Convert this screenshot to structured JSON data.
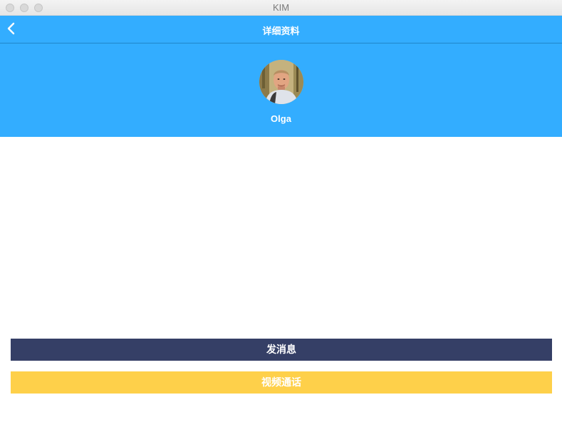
{
  "window": {
    "title": "KIM"
  },
  "navbar": {
    "back_icon": "chevron-left-icon",
    "title": "详细资料"
  },
  "profile": {
    "avatar_icon": "user-avatar",
    "name": "Olga"
  },
  "actions": {
    "send_message_label": "发消息",
    "video_call_label": "视频通话"
  },
  "colors": {
    "primary": "#33adff",
    "message_button": "#353f66",
    "video_button": "#fed04a"
  }
}
